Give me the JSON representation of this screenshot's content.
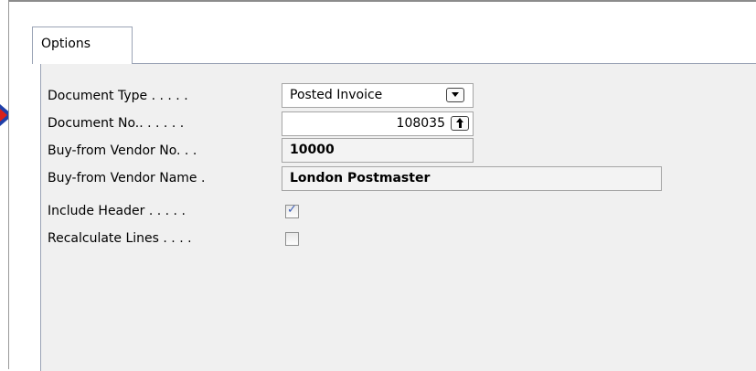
{
  "tabs": [
    {
      "label": "Options"
    }
  ],
  "fields": {
    "document_type": {
      "label": "Document Type . . . . .",
      "value": "Posted Invoice"
    },
    "document_no": {
      "label": "Document No.. . . . . .",
      "value": "108035"
    },
    "buy_from_vendor_no": {
      "label": "Buy-from Vendor No. . .",
      "value": "10000"
    },
    "buy_from_vendor_name": {
      "label": "Buy-from Vendor Name .",
      "value": "London Postmaster"
    },
    "include_header": {
      "label": "Include Header . . . . .",
      "checked": true
    },
    "recalculate_lines": {
      "label": "Recalculate Lines . . . .",
      "checked": false
    }
  },
  "icons": {
    "dropdown": "chevron-down-icon",
    "lookup": "arrow-up-icon",
    "checkmark": "checkmark-icon",
    "pointer": "arrow-right-icon"
  },
  "colors": {
    "panel": "#f0f0f0",
    "check": "#3a5cb8",
    "pointer_outer": "#1f3fa8",
    "pointer_inner": "#d8201a"
  }
}
